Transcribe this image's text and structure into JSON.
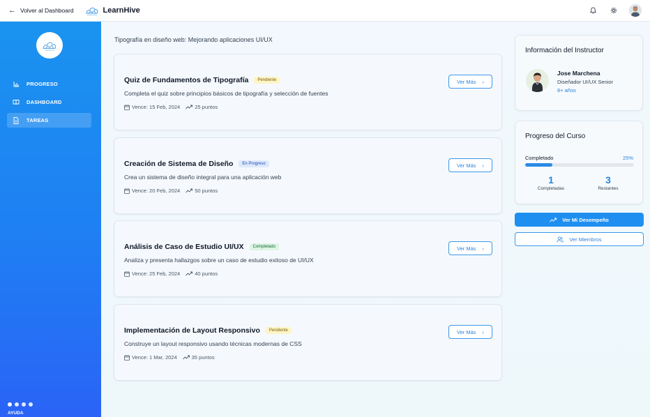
{
  "topbar": {
    "back_label": "Volver al Dashboard",
    "brand_name": "LearnHive",
    "icons": [
      "bell-icon",
      "gear-icon",
      "user-avatar"
    ]
  },
  "sidebar": {
    "items": [
      {
        "label": "PROGRESO",
        "icon": "bar-chart-icon",
        "active": false
      },
      {
        "label": "DASHBOARD",
        "icon": "book-open-icon",
        "active": false
      },
      {
        "label": "TAREAS",
        "icon": "document-icon",
        "active": true
      }
    ],
    "help_label": "AYUDA"
  },
  "main": {
    "course_title": "Tipografía en diseño web: Mejorando aplicaciones UI/UX",
    "more_label": "Ver Más",
    "tasks": [
      {
        "title": "Quiz de Fundamentos de Tipografía",
        "status": "Pendiente",
        "description": "Completa el quiz sobre principios básicos de tipografía y selección de fuentes",
        "due": "Vence: 15 Feb, 2024",
        "points": "25 puntos"
      },
      {
        "title": "Creación de Sistema de Diseño",
        "status": "En Progreso",
        "description": "Crea un sistema de diseño integral para una aplicación web",
        "due": "Vence: 20 Feb, 2024",
        "points": "50 puntos"
      },
      {
        "title": "Análisis de Caso de Estudio UI/UX",
        "status": "Completado",
        "description": "Analiza y presenta hallazgos sobre un caso de estudio exitoso de UI/UX",
        "due": "Vence: 25 Feb, 2024",
        "points": "40 puntos"
      },
      {
        "title": "Implementación de Layout Responsivo",
        "status": "Pendiente",
        "description": "Construye un layout responsivo usando técnicas modernas de CSS",
        "due": "Vence: 1 Mar, 2024",
        "points": "35 puntos"
      }
    ]
  },
  "instructor": {
    "heading": "Información del Instructor",
    "name": "Jose Marchena",
    "role": "Diseñador UI/UX Senior",
    "years": "8+ años"
  },
  "progress": {
    "heading": "Progreso del Curso",
    "label": "Completado",
    "percent_text": "25%",
    "percent_value": 25,
    "completed_count": "1",
    "completed_label": "Completadas",
    "remaining_count": "3",
    "remaining_label": "Restantes"
  },
  "actions": {
    "performance_label": "Ver Mi Desempeño",
    "members_label": "Ver Miembros"
  },
  "colors": {
    "accent": "#1e8ff0",
    "sidebar_top": "#1a93f0",
    "sidebar_bottom": "#2a63f6",
    "pending_bg": "#fdf5c6",
    "progress_bg": "#dde9fb",
    "completed_bg": "#dcf5e3"
  }
}
